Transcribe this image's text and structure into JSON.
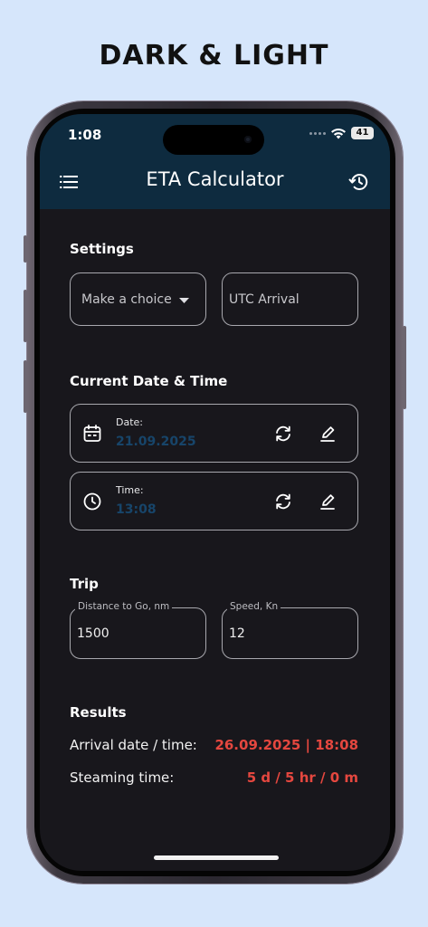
{
  "promo": {
    "title": "DARK & LIGHT"
  },
  "status_bar": {
    "time": "1:08",
    "battery": "41"
  },
  "header": {
    "title": "ETA Calculator",
    "menu_icon": "menu-icon",
    "history_icon": "history-icon"
  },
  "settings": {
    "title": "Settings",
    "choice_placeholder": "Make a choice",
    "utc_placeholder": "UTC Arrival"
  },
  "current": {
    "title": "Current Date & Time",
    "date_label": "Date:",
    "date_value": "21.09.2025",
    "time_label": "Time:",
    "time_value": "13:08"
  },
  "trip": {
    "title": "Trip",
    "distance_label": "Distance to Go, nm",
    "distance_value": "1500",
    "speed_label": "Speed, Kn",
    "speed_value": "12"
  },
  "results": {
    "title": "Results",
    "arrival_label": "Arrival date / time:",
    "arrival_value": "26.09.2025 | 18:08",
    "steaming_label": "Steaming time:",
    "steaming_value": "5 d / 5 hr / 0 m"
  },
  "colors": {
    "header_bg": "#0e2b3f",
    "screen_bg": "#18171c",
    "accent_value": "#17456a",
    "result_red": "#e5473f",
    "page_bg": "#d6e6fb"
  }
}
